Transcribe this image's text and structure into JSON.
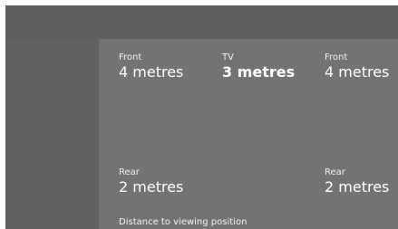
{
  "speakers": {
    "front_left": {
      "label": "Front",
      "value": "4 metres"
    },
    "tv": {
      "label": "TV",
      "value": "3 metres"
    },
    "front_right": {
      "label": "Front",
      "value": "4 metres"
    },
    "rear_left": {
      "label": "Rear",
      "value": "2 metres"
    },
    "rear_right": {
      "label": "Rear",
      "value": "2 metres"
    }
  },
  "footer_text": "Distance to viewing position",
  "colors": {
    "background": "#6e6f70",
    "left_panel": "#606162",
    "main_panel": "#727374",
    "text": "#ffffff"
  }
}
